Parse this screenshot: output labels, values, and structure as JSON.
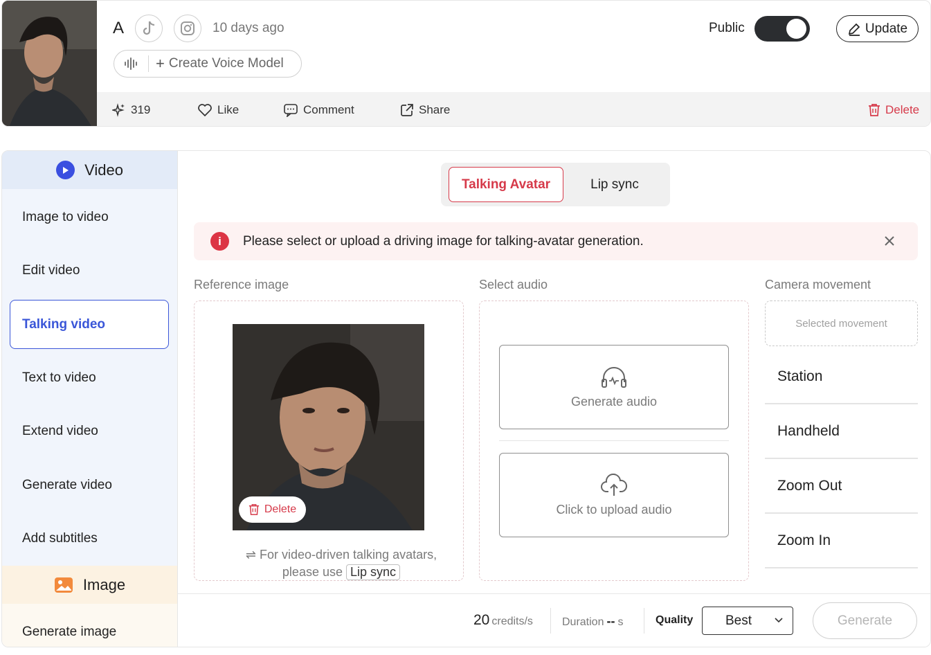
{
  "profile": {
    "name": "A",
    "time": "10 days ago",
    "voice_model_label": "Create Voice Model",
    "public_label": "Public",
    "public_enabled": true,
    "update_label": "Update",
    "icons": [
      "tiktok-icon",
      "instagram-icon",
      "voice-wave-icon",
      "pencil-icon"
    ]
  },
  "actions": {
    "generations": "319",
    "like": "Like",
    "comment": "Comment",
    "share": "Share",
    "delete": "Delete"
  },
  "sidebar": {
    "video_header": "Video",
    "items": [
      "Image to video",
      "Edit video",
      "Talking video",
      "Text to video",
      "Extend video",
      "Generate video",
      "Add subtitles"
    ],
    "active_item": "Talking video",
    "image_header": "Image",
    "image_items": [
      "Generate image"
    ]
  },
  "tabs": [
    "Talking Avatar",
    "Lip sync"
  ],
  "alert": {
    "message": "Please select or upload a driving image for talking-avatar generation."
  },
  "reference": {
    "label": "Reference image",
    "delete_label": "Delete",
    "hint_line1": "For video-driven talking avatars,",
    "hint_line2": "please use",
    "hint_link": "Lip sync"
  },
  "audio": {
    "label": "Select audio",
    "generate": "Generate audio",
    "upload": "Click to upload audio"
  },
  "camera": {
    "label": "Camera movement",
    "placeholder": "Selected movement",
    "movements": [
      "Station",
      "Handheld",
      "Zoom Out",
      "Zoom In"
    ]
  },
  "footer": {
    "credits_value": "20",
    "credits_unit": "credits/s",
    "duration_label": "Duration",
    "duration_value": "--",
    "duration_unit": "s",
    "quality_label": "Quality",
    "quality_value": "Best",
    "generate_label": "Generate"
  },
  "colors": {
    "accent_red": "#d63a4a",
    "accent_blue": "#3a56d8",
    "toggle_dark": "#2b2d30"
  }
}
